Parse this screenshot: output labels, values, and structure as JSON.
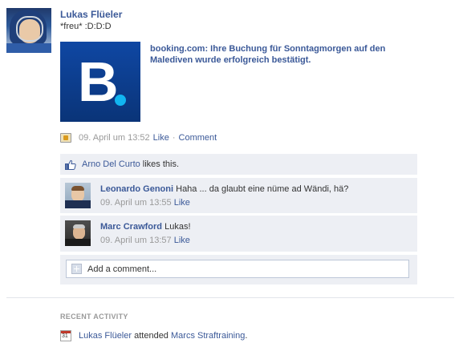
{
  "post": {
    "author": "Lukas Flüeler",
    "status": "*freu* :D:D:D",
    "attachment": {
      "logo_letter": "B",
      "text": "booking.com: Ihre Buchung für Sonntagmorgen auf den Malediven wurde erfolgreich bestätigt."
    },
    "meta": {
      "timestamp": "09. April um 13:52",
      "like_label": "Like",
      "separator": "·",
      "comment_label": "Comment"
    }
  },
  "likes": {
    "liker": "Arno Del Curto",
    "text": "likes this."
  },
  "comments": [
    {
      "author": "Leonardo Genoni",
      "text": "Haha ... da glaubt eine nüme ad Wändi, hä?",
      "timestamp": "09. April um 13:55",
      "like_label": "Like"
    },
    {
      "author": "Marc Crawford",
      "text": "Lukas!",
      "timestamp": "09. April um 13:57",
      "like_label": "Like"
    }
  ],
  "add_comment": {
    "placeholder": "Add a comment..."
  },
  "recent_activity": {
    "title": "RECENT ACTIVITY",
    "calendar_day": "31",
    "actor": "Lukas Flüeler",
    "verb": "attended",
    "event": "Marcs Straftraining",
    "end": "."
  },
  "colors": {
    "link": "#3b5998",
    "feedback_bg": "#edeff4",
    "booking_blue": "#0f47a3",
    "booking_dot": "#11b5f0"
  }
}
